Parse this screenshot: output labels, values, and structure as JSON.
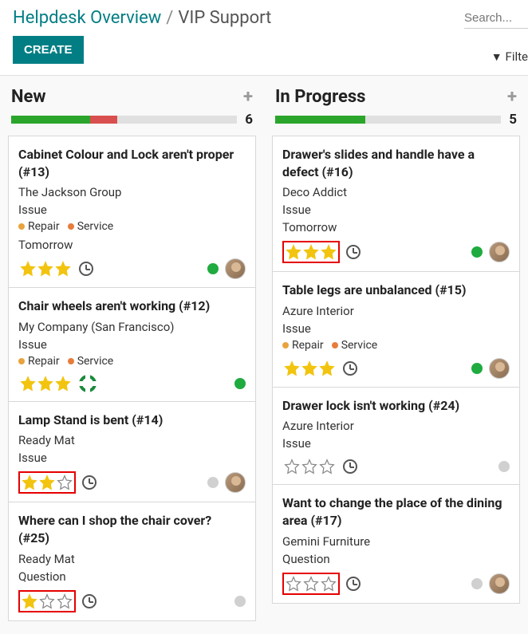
{
  "breadcrumb": {
    "root": "Helpdesk Overview",
    "current": "VIP Support"
  },
  "create_label": "CREATE",
  "search_placeholder": "Search...",
  "filter_label": "Filte",
  "colors": {
    "green": "#2ba52b",
    "red": "#d94f4f",
    "grey": "#e0e0e0",
    "amber": "#e8a33d",
    "orange": "#e77c3c",
    "dot_green": "#1fab3f",
    "dot_grey": "#d0d0d0",
    "star_fill": "#f2c40f",
    "star_empty": "#888"
  },
  "columns": [
    {
      "title": "New",
      "count": 6,
      "bar": [
        {
          "color": "green",
          "w": 35
        },
        {
          "color": "red",
          "w": 12
        }
      ],
      "cards": [
        {
          "title": "Cabinet Colour and Lock aren't proper (#13)",
          "company": "The Jackson Group",
          "type": "Issue",
          "tags": [
            {
              "label": "Repair",
              "color": "amber"
            },
            {
              "label": "Service",
              "color": "orange"
            }
          ],
          "extra": "Tomorrow",
          "stars": 3,
          "max": 3,
          "boxed": false,
          "footer_icon": "clock",
          "status": "green",
          "avatar": true
        },
        {
          "title": "Chair wheels aren't working (#12)",
          "company": "My Company (San Francisco)",
          "type": "Issue",
          "tags": [
            {
              "label": "Repair",
              "color": "amber"
            },
            {
              "label": "Service",
              "color": "orange"
            }
          ],
          "stars": 3,
          "max": 3,
          "boxed": false,
          "footer_icon": "lifebuoy",
          "status": "green",
          "avatar": false
        },
        {
          "title": "Lamp Stand is bent (#14)",
          "company": "Ready Mat",
          "type": "Issue",
          "stars": 2,
          "max": 3,
          "boxed": true,
          "footer_icon": "clock",
          "status": "grey",
          "avatar": true
        },
        {
          "title": "Where can I shop the chair cover? (#25)",
          "company": "Ready Mat",
          "type": "Question",
          "stars": 1,
          "max": 3,
          "boxed": true,
          "footer_icon": "clock",
          "status": "grey",
          "avatar": false
        }
      ]
    },
    {
      "title": "In Progress",
      "count": 5,
      "bar": [
        {
          "color": "green",
          "w": 40
        }
      ],
      "cards": [
        {
          "title": "Drawer's slides and handle have a defect (#16)",
          "company": "Deco Addict",
          "type": "Issue",
          "extra": "Tomorrow",
          "stars": 3,
          "max": 3,
          "boxed": true,
          "footer_icon": "clock",
          "status": "green",
          "avatar": true
        },
        {
          "title": "Table legs are unbalanced (#15)",
          "company": "Azure Interior",
          "type": "Issue",
          "tags": [
            {
              "label": "Repair",
              "color": "amber"
            },
            {
              "label": "Service",
              "color": "orange"
            }
          ],
          "stars": 3,
          "max": 3,
          "boxed": false,
          "footer_icon": "clock",
          "status": "green",
          "avatar": true
        },
        {
          "title": "Drawer lock isn't working (#24)",
          "company": "Azure Interior",
          "type": "Issue",
          "stars": 0,
          "max": 3,
          "boxed": false,
          "footer_icon": "clock",
          "status": "grey",
          "avatar": false
        },
        {
          "title": "Want to change the place of the dining area (#17)",
          "company": "Gemini Furniture",
          "type": "Question",
          "stars": 0,
          "max": 3,
          "boxed": true,
          "footer_icon": "clock",
          "status": "grey",
          "avatar": true
        }
      ]
    }
  ]
}
